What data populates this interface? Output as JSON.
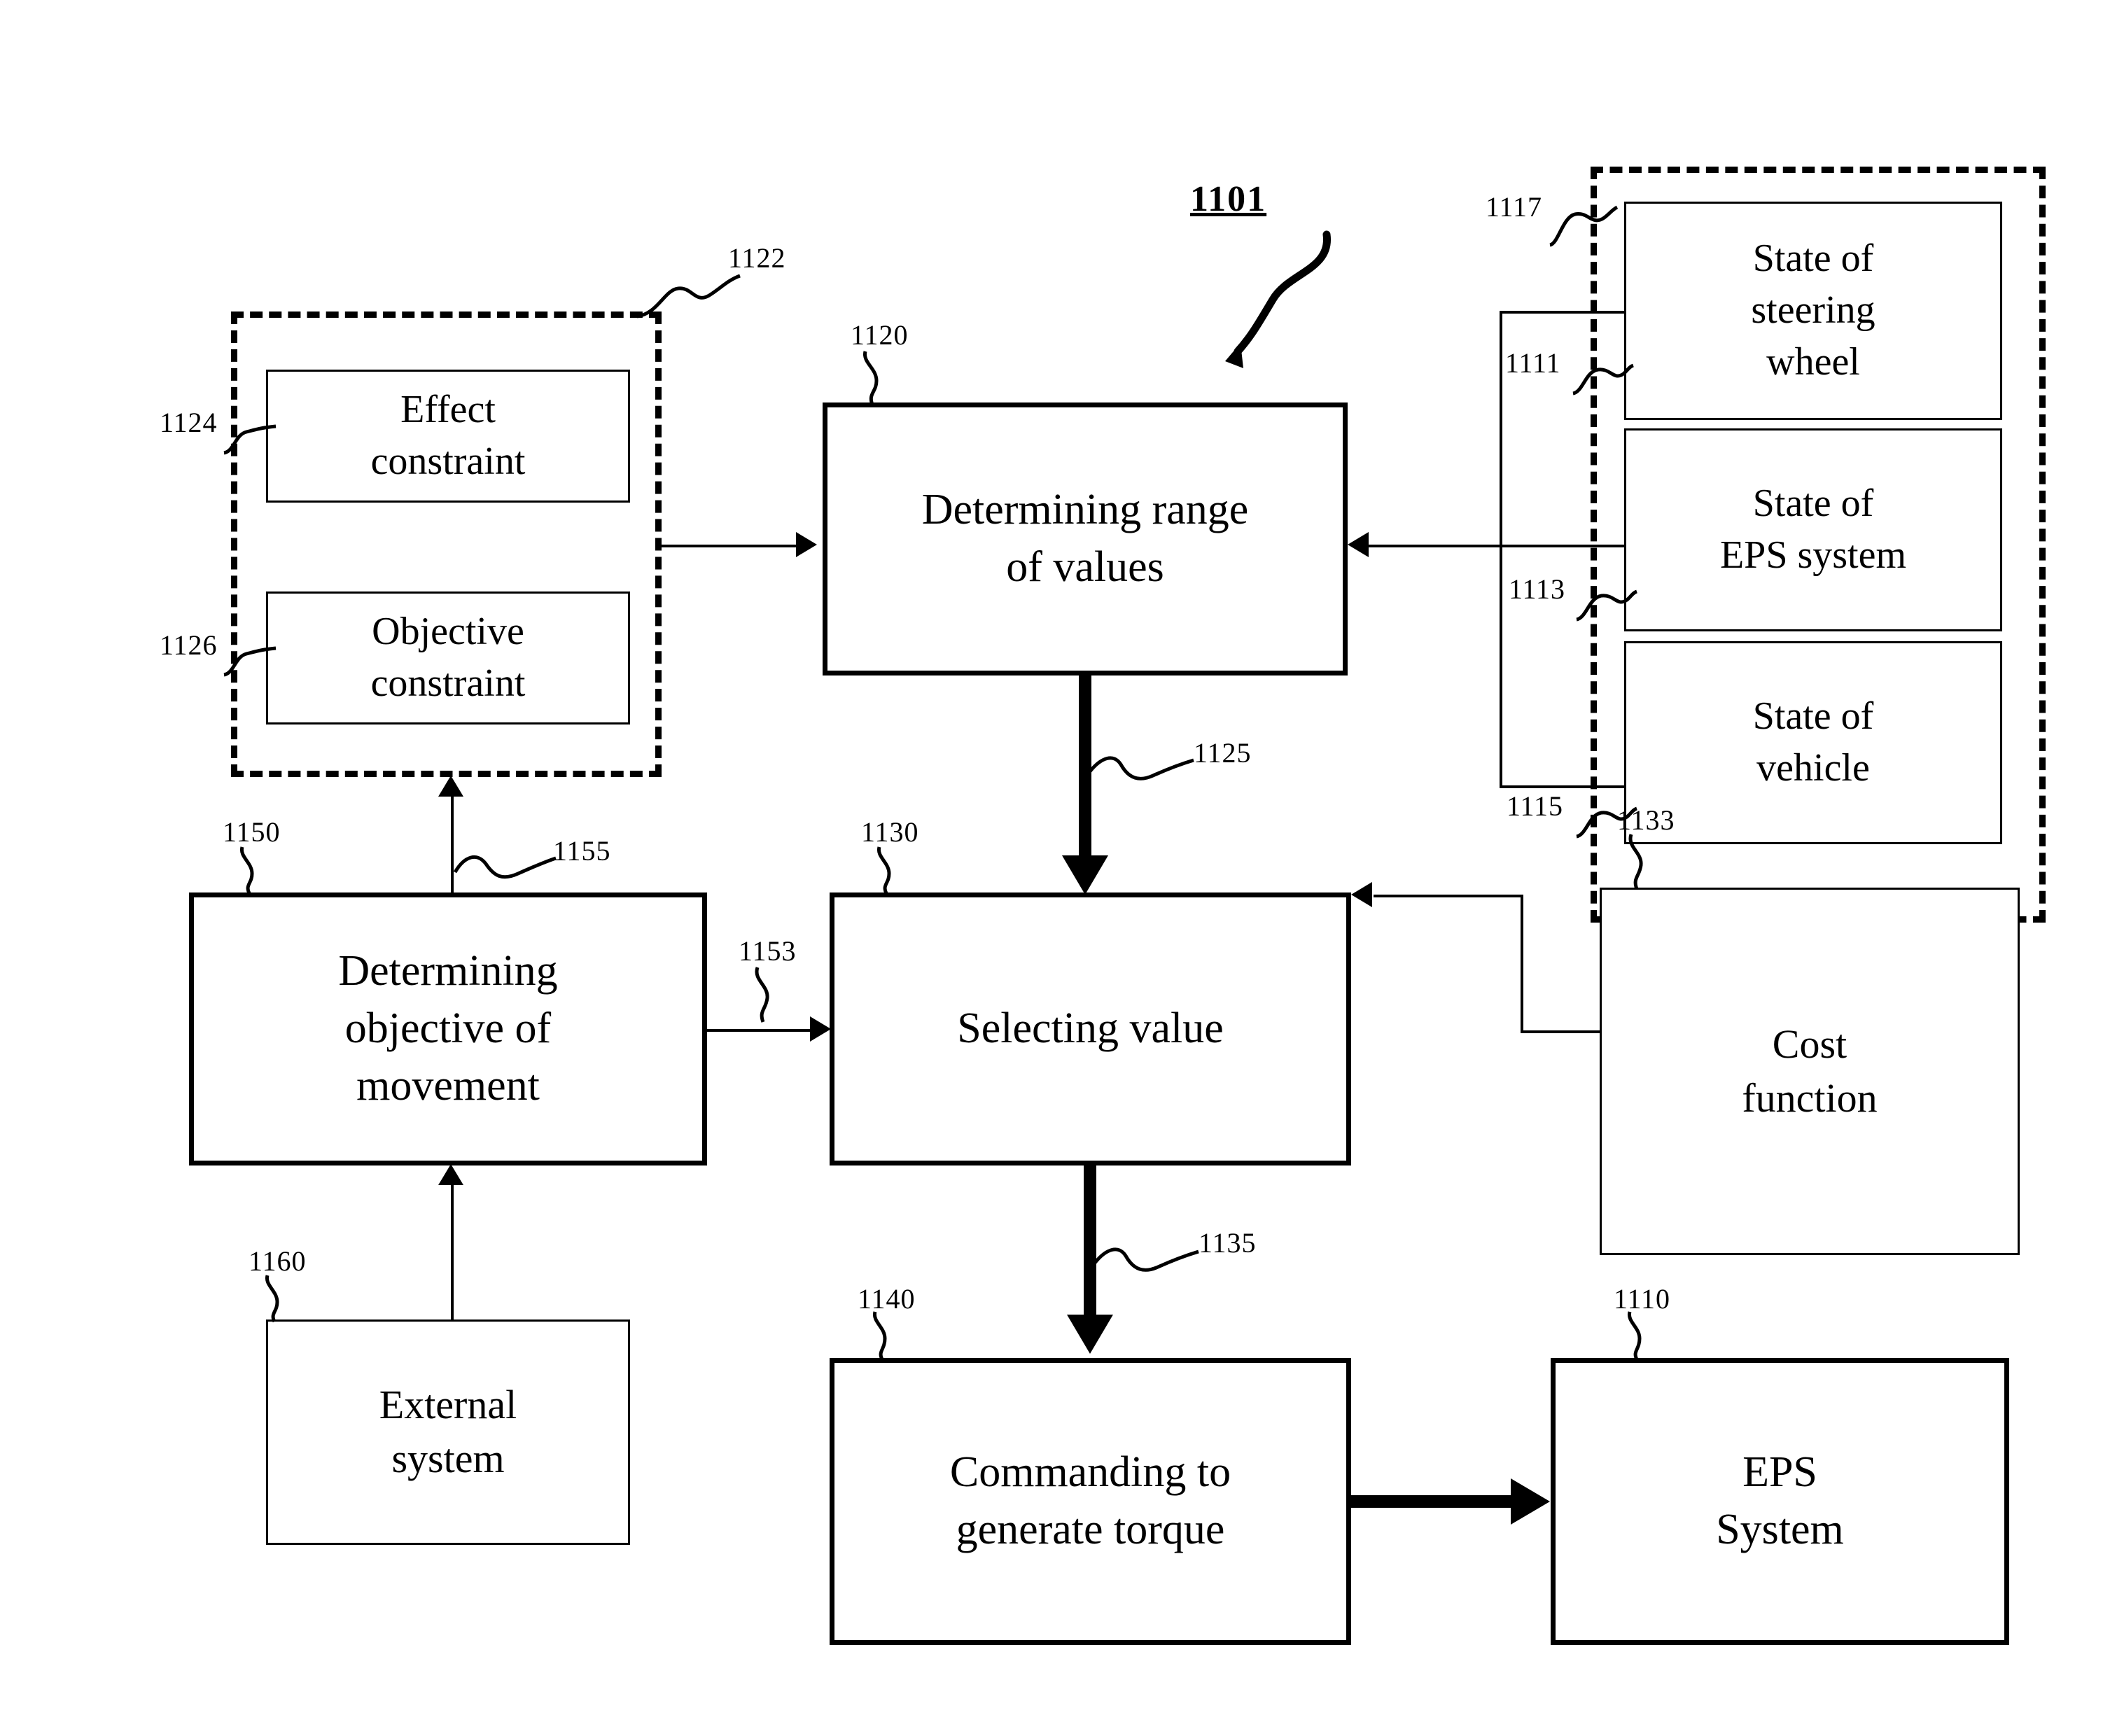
{
  "figure": {
    "id_label": "1101"
  },
  "blocks": {
    "determining_range": {
      "label": "Determining range\nof values",
      "ref": "1120"
    },
    "selecting_value": {
      "label": "Selecting value",
      "ref": "1130"
    },
    "commanding_torque": {
      "label": "Commanding to\ngenerate torque",
      "ref": "1140"
    },
    "eps_system": {
      "label": "EPS\nSystem",
      "ref": "1110"
    },
    "determining_objective": {
      "label": "Determining\nobjective of\nmovement",
      "ref": "1150"
    },
    "external_system": {
      "label": "External\nsystem",
      "ref": "1160"
    },
    "cost_function": {
      "label": "Cost\nfunction",
      "ref": "1133"
    },
    "effect_constraint": {
      "label": "Effect\nconstraint",
      "ref": "1124"
    },
    "objective_constraint": {
      "label": "Objective\nconstraint",
      "ref": "1126"
    },
    "state_steering_wheel": {
      "label": "State of\nsteering\nwheel",
      "ref": "1111"
    },
    "state_eps_system": {
      "label": "State of\nEPS system",
      "ref": "1113"
    },
    "state_vehicle": {
      "label": "State of\nvehicle",
      "ref": "1115"
    }
  },
  "groups": {
    "constraints_group": {
      "ref": "1122"
    },
    "states_group": {
      "ref": "1117"
    }
  },
  "connectors": {
    "range_to_select": {
      "ref": "1125"
    },
    "select_to_command": {
      "ref": "1135"
    },
    "objective_to_constraint": {
      "ref": "1155"
    },
    "objective_to_select": {
      "ref": "1153"
    }
  }
}
